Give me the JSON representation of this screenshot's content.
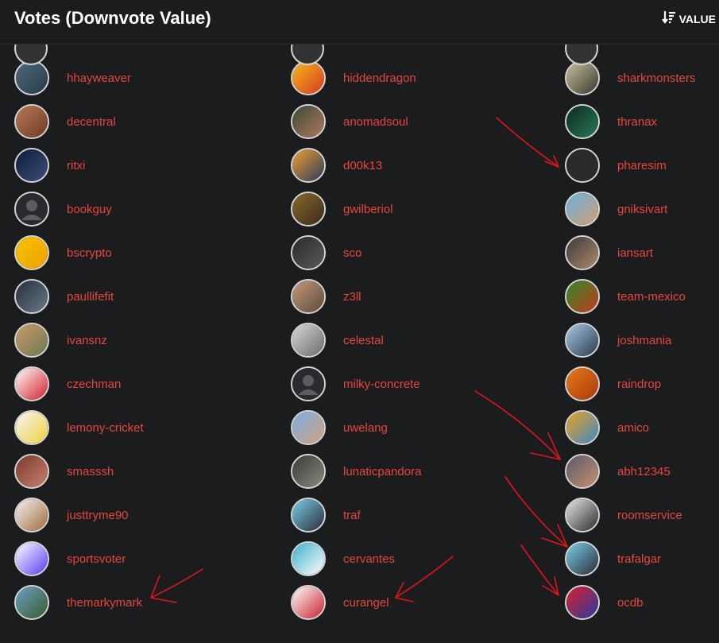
{
  "header": {
    "title": "Votes (Downvote Value)",
    "sort_label": "VALUE",
    "sort_icon": "sort-descending-icon"
  },
  "colors": {
    "username": "#e8453c",
    "background": "#1b1c1e",
    "arrow": "#e0141b"
  },
  "columns": [
    {
      "voters": [
        {
          "name": "hhayweaver",
          "av": [
            "#4c6a7c",
            "#2a3a46"
          ]
        },
        {
          "name": "decentral",
          "av": [
            "#b97a56",
            "#6e3a24"
          ]
        },
        {
          "name": "ritxi",
          "av": [
            "#0e1b3a",
            "#3e4e7a"
          ]
        },
        {
          "name": "bookguy",
          "av": [
            "#2b2b2b",
            "#4a4a4a"
          ]
        },
        {
          "name": "bscrypto",
          "av": [
            "#f5c400",
            "#f0a000"
          ]
        },
        {
          "name": "paullifefit",
          "av": [
            "#24303a",
            "#6a7a88"
          ]
        },
        {
          "name": "ivansnz",
          "av": [
            "#c99a6a",
            "#6d7a52"
          ]
        },
        {
          "name": "czechman",
          "av": [
            "#ffffff",
            "#d21f2b"
          ]
        },
        {
          "name": "lemony-cricket",
          "av": [
            "#f5f5f5",
            "#efd13a"
          ]
        },
        {
          "name": "smasssh",
          "av": [
            "#7a3a2a",
            "#c98070"
          ]
        },
        {
          "name": "justtryme90",
          "av": [
            "#f3f3f3",
            "#a06a3a"
          ]
        },
        {
          "name": "sportsvoter",
          "av": [
            "#ffffff",
            "#5a3cf0"
          ]
        },
        {
          "name": "themarkymark",
          "av": [
            "#6aa0c8",
            "#3a5a2a"
          ]
        }
      ]
    },
    {
      "voters": [
        {
          "name": "hiddendragon",
          "av": [
            "#f5b820",
            "#d83a1a"
          ]
        },
        {
          "name": "anomadsoul",
          "av": [
            "#3a4a3a",
            "#b07a5a"
          ]
        },
        {
          "name": "d00k13",
          "av": [
            "#f0a030",
            "#2a3a5a"
          ]
        },
        {
          "name": "gwilberiol",
          "av": [
            "#8a6a2a",
            "#3a2a1a"
          ]
        },
        {
          "name": "sco",
          "av": [
            "#2a2a2a",
            "#5a5a5a"
          ]
        },
        {
          "name": "z3ll",
          "av": [
            "#c89a7a",
            "#5a4a3a"
          ]
        },
        {
          "name": "celestal",
          "av": [
            "#d8d8d8",
            "#6a6a6a"
          ]
        },
        {
          "name": "milky-concrete",
          "av": [
            "#2b2b2b",
            "#4a4a4a"
          ]
        },
        {
          "name": "uwelang",
          "av": [
            "#7ab0e0",
            "#d0a080"
          ]
        },
        {
          "name": "lunaticpandora",
          "av": [
            "#3a3a3a",
            "#8a8a7a"
          ]
        },
        {
          "name": "traf",
          "av": [
            "#7ad0e8",
            "#2a2a3a"
          ]
        },
        {
          "name": "cervantes",
          "av": [
            "#3ab0c8",
            "#ffffff"
          ]
        },
        {
          "name": "curangel",
          "av": [
            "#ffffff",
            "#c8202a"
          ]
        }
      ]
    },
    {
      "voters": [
        {
          "name": "sharkmonsters",
          "av": [
            "#c8c0a0",
            "#3a3a2a"
          ]
        },
        {
          "name": "thranax",
          "av": [
            "#0a2a1a",
            "#2a7a5a"
          ]
        },
        {
          "name": "pharesim",
          "av": [
            "#2a2a2a",
            "#2a2a2a"
          ]
        },
        {
          "name": "gniksivart",
          "av": [
            "#6ab0e0",
            "#d0a070"
          ]
        },
        {
          "name": "iansart",
          "av": [
            "#3a3a3a",
            "#b08a6a"
          ]
        },
        {
          "name": "team-mexico",
          "av": [
            "#2a8a2a",
            "#c83a1a"
          ]
        },
        {
          "name": "joshmania",
          "av": [
            "#a8c8e8",
            "#2a3a4a"
          ]
        },
        {
          "name": "raindrop",
          "av": [
            "#e87a1a",
            "#a83a0a"
          ]
        },
        {
          "name": "amico",
          "av": [
            "#f0a020",
            "#3a8ac8"
          ]
        },
        {
          "name": "abh12345",
          "av": [
            "#5a5a6a",
            "#c89070"
          ]
        },
        {
          "name": "roomservice",
          "av": [
            "#e8e8e8",
            "#2a2a2a"
          ]
        },
        {
          "name": "trafalgar",
          "av": [
            "#7ad0e8",
            "#2a2a3a"
          ]
        },
        {
          "name": "ocdb",
          "av": [
            "#d8202a",
            "#2a3aa0"
          ]
        }
      ]
    }
  ]
}
